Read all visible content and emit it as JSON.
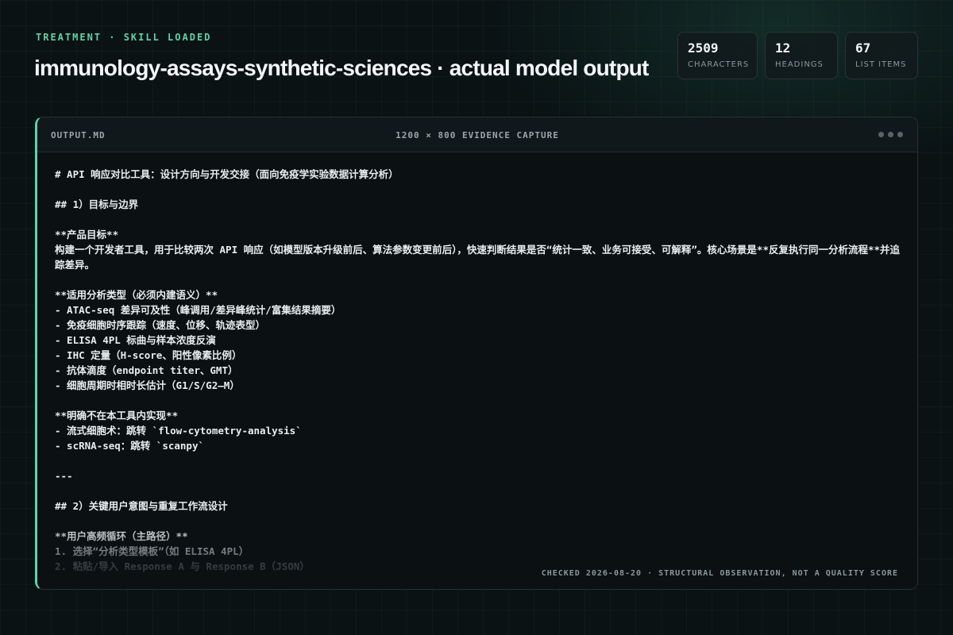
{
  "header": {
    "eyebrow": "TREATMENT · SKILL LOADED",
    "title": "immunology-assays-synthetic-sciences · actual model output"
  },
  "stats": [
    {
      "value": "2509",
      "label": "CHARACTERS"
    },
    {
      "value": "12",
      "label": "HEADINGS"
    },
    {
      "value": "67",
      "label": "LIST ITEMS"
    }
  ],
  "panel": {
    "filename": "OUTPUT.MD",
    "caption": "1200 × 800 EVIDENCE CAPTURE",
    "footer_note": "CHECKED 2026-08-20 · STRUCTURAL OBSERVATION, NOT A QUALITY SCORE",
    "lines": [
      "# API 响应对比工具：设计方向与开发交接（面向免疫学实验数据计算分析）",
      "",
      "## 1）目标与边界",
      "",
      "**产品目标**",
      "构建一个开发者工具，用于比较两次 API 响应（如模型版本升级前后、算法参数变更前后），快速判断结果是否“统计一致、业务可接受、可解释”。核心场景是**反复执行同一分析流程**并追踪差异。",
      "",
      "**适用分析类型（必须内建语义）**",
      "- ATAC-seq 差异可及性（峰调用/差异峰统计/富集结果摘要）",
      "- 免疫细胞时序跟踪（速度、位移、轨迹表型）",
      "- ELISA 4PL 标曲与样本浓度反演",
      "- IHC 定量（H-score、阳性像素比例）",
      "- 抗体滴度（endpoint titer、GMT）",
      "- 细胞周期时相时长估计（G1/S/G2–M）",
      "",
      "**明确不在本工具内实现**",
      "- 流式细胞术：跳转 `flow-cytometry-analysis`",
      "- scRNA-seq：跳转 `scanpy`",
      "",
      "---",
      "",
      "## 2）关键用户意图与重复工作流设计",
      "",
      "**用户高频循环（主路径）**",
      "1. 选择“分析类型模板”（如 ELISA 4PL）",
      "2. 粘贴/导入 Response A 与 Response B（JSON）"
    ]
  }
}
